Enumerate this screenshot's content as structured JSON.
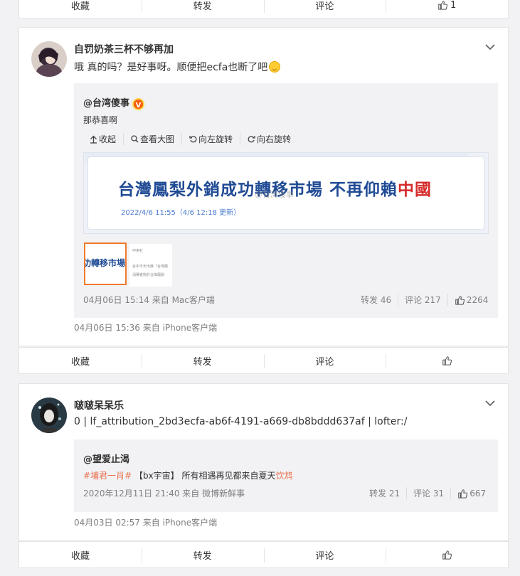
{
  "top_action_bar": {
    "collect": "收藏",
    "repost": "转发",
    "comment": "评论",
    "like_count": "1"
  },
  "post1": {
    "author": "自罚奶茶三杯不够再加",
    "text": "哦 真的吗？是好事呀。顺便把ecfa也断了吧",
    "repost": {
      "author": "@台湾傻事",
      "badge": "V",
      "text": "那恭喜啊",
      "tools": [
        "收起",
        "查看大图",
        "向左旋转",
        "向右旋转"
      ],
      "image": {
        "headline": "台灣鳳梨外銷成功轉移市場 不再仰賴",
        "headline_red": "中國",
        "date": "2022/4/6 11:55（4/6 12:18 更新）",
        "watermark": "@台湾傻事"
      },
      "thumb1_text": "功轉移市場",
      "thumb2_lines": [
        "中央社",
        "台中今天出席「台灣鳳",
        "消費者對於台灣鳳梨"
      ],
      "time": "04月06日 15:14 来自 Mac客户端",
      "reposts": "转发 46",
      "comments": "评论 217",
      "likes": "2264"
    },
    "time": "04月06日 15:36  来自 iPhone客户端",
    "actions": {
      "collect": "收藏",
      "repost": "转发",
      "comment": "评论"
    }
  },
  "post2": {
    "author": "啵啵呆呆乐",
    "text": "0 | lf_attribution_2bd3ecfa-ab6f-4191-a669-db8bddd637af | lofter:/",
    "repost": {
      "author": "@望爱止渴",
      "topic": "#埔君一肖#",
      "text": "【bx宇宙】 所有相遇再见都来自夏天",
      "link": "饮鸩",
      "time": "2020年12月11日 21:40 来自 微博新鲜事",
      "reposts": "转发 21",
      "comments": "评论 31",
      "likes": "667"
    },
    "time": "04月03日 02:57  来自 iPhone客户端",
    "actions": {
      "collect": "收藏",
      "repost": "转发",
      "comment": "评论"
    }
  },
  "colors": {
    "accent": "#eb7350",
    "headline_blue": "#1f4a94",
    "badge_orange": "#f35e0a"
  }
}
